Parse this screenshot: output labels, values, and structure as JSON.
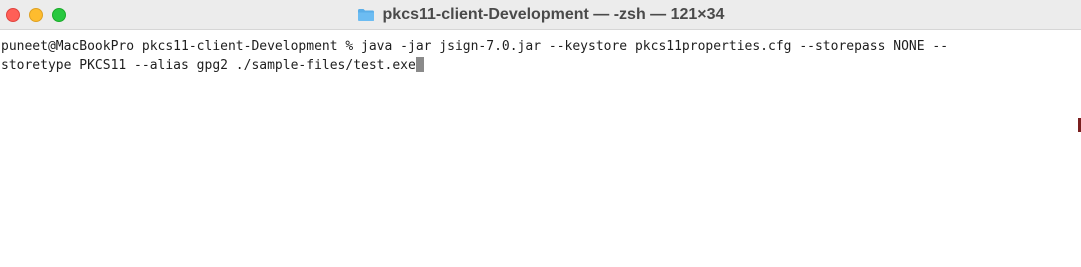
{
  "window": {
    "title": "pkcs11-client-Development — -zsh — 121×34",
    "title_icon": "folder-icon",
    "traffic_lights": {
      "close_color": "#ff5f57",
      "minimize_color": "#febc2e",
      "zoom_color": "#28c840"
    }
  },
  "terminal": {
    "line1": "puneet@MacBookPro pkcs11-client-Development % java -jar jsign-7.0.jar --keystore pkcs11properties.cfg --storepass NONE --",
    "line2": "storetype PKCS11 --alias gpg2 ./sample-files/test.exe"
  }
}
